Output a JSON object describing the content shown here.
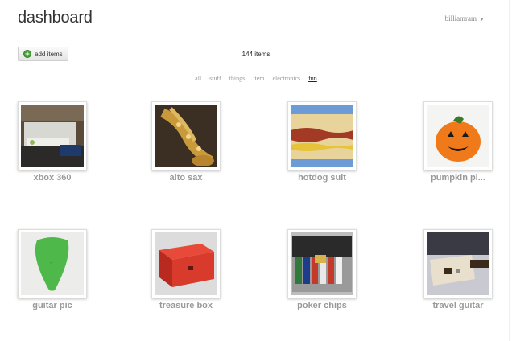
{
  "header": {
    "title": "dashboard",
    "username": "billiamram"
  },
  "toolbar": {
    "add_label": "add items",
    "item_count": "144 items"
  },
  "filters": [
    {
      "label": "all",
      "active": false
    },
    {
      "label": "stuff",
      "active": false
    },
    {
      "label": "things",
      "active": false
    },
    {
      "label": "item",
      "active": false
    },
    {
      "label": "electronics",
      "active": false
    },
    {
      "label": "fun",
      "active": true
    }
  ],
  "items": [
    {
      "label": "xbox 360"
    },
    {
      "label": "alto sax"
    },
    {
      "label": "hotdog suit"
    },
    {
      "label": "pumpkin pl..."
    },
    {
      "label": "guitar pic"
    },
    {
      "label": "treasure box"
    },
    {
      "label": "poker chips"
    },
    {
      "label": "travel guitar"
    }
  ]
}
